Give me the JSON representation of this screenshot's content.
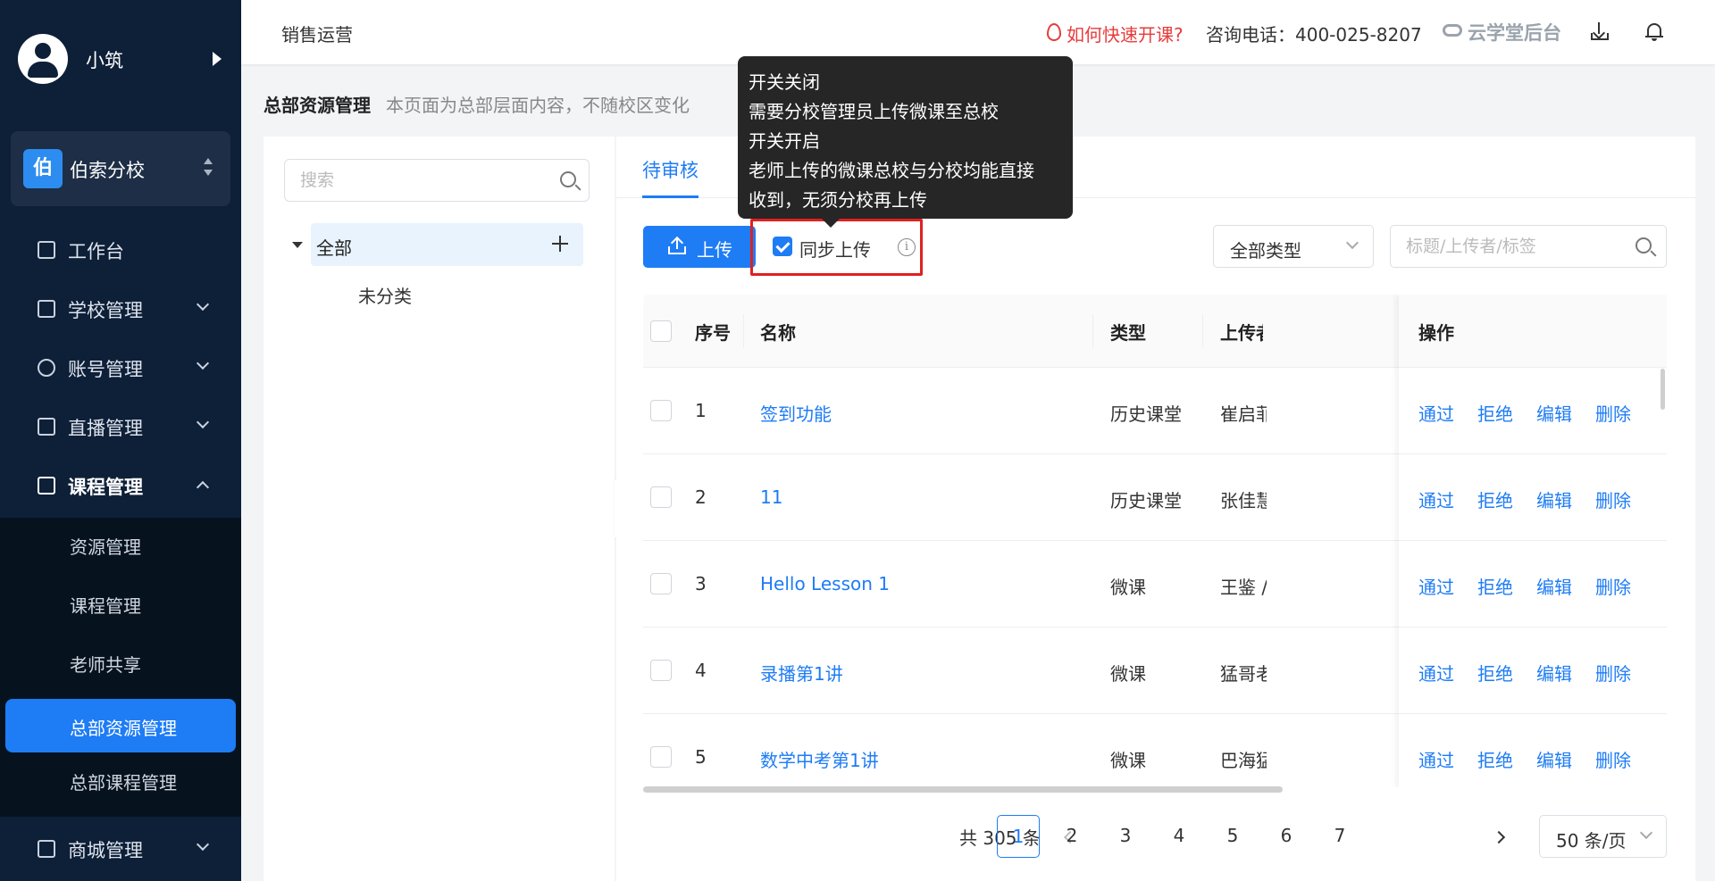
{
  "user": {
    "name": "小筑"
  },
  "school": {
    "badge": "伯",
    "name": "伯索分校"
  },
  "nav": {
    "items": [
      {
        "label": "工作台"
      },
      {
        "label": "学校管理"
      },
      {
        "label": "账号管理"
      },
      {
        "label": "直播管理"
      },
      {
        "label": "课程管理"
      }
    ],
    "sub_items": [
      {
        "label": "资源管理"
      },
      {
        "label": "课程管理"
      },
      {
        "label": "老师共享"
      },
      {
        "label": "总部资源管理"
      },
      {
        "label": "总部课程管理"
      }
    ],
    "shop": {
      "label": "商城管理"
    }
  },
  "header": {
    "title": "销售运营",
    "fast_course": "如何快速开课?",
    "phone": "咨询电话：400-025-8207",
    "logo": "云学堂后台"
  },
  "page": {
    "title": "总部资源管理",
    "desc": "本页面为总部层面内容，不随校区变化"
  },
  "tree": {
    "search_placeholder": "搜索",
    "all_label": "全部",
    "uncategorized": "未分类"
  },
  "tabs": [
    {
      "label": "待审核"
    }
  ],
  "toolbar": {
    "upload_label": "上传",
    "sync_label": "同步上传",
    "sync_checked": true,
    "type_select": "全部类型",
    "search_placeholder": "标题/上传者/标签"
  },
  "tooltip": {
    "lines": [
      "开关关闭",
      "需要分校管理员上传微课至总校",
      "开关开启",
      "老师上传的微课总校与分校均能直接",
      "收到，无须分校再上传"
    ]
  },
  "table": {
    "columns": {
      "index": "序号",
      "name": "名称",
      "type": "类型",
      "uploader": "上传者",
      "ops": "操作"
    },
    "ops": [
      "通过",
      "拒绝",
      "编辑",
      "删除"
    ],
    "rows": [
      {
        "index": "1",
        "name": "签到功能",
        "type": "历史课堂",
        "uploader": "崔启菲"
      },
      {
        "index": "2",
        "name": "11",
        "type": "历史课堂",
        "uploader": "张佳慧"
      },
      {
        "index": "3",
        "name": "Hello Lesson 1",
        "type": "微课",
        "uploader": "王鉴 /"
      },
      {
        "index": "4",
        "name": "录播第1讲",
        "type": "微课",
        "uploader": "猛哥老"
      },
      {
        "index": "5",
        "name": "数学中考第1讲",
        "type": "微课",
        "uploader": "巴海猛"
      }
    ]
  },
  "pagination": {
    "total": "共 305 条",
    "pages": [
      "1",
      "2",
      "3",
      "4",
      "5",
      "6",
      "7"
    ],
    "current": "1",
    "page_size": "50 条/页"
  },
  "colors": {
    "primary": "#1e7cf5",
    "sidebar": "#0e1f38",
    "highlight": "#e02020"
  }
}
